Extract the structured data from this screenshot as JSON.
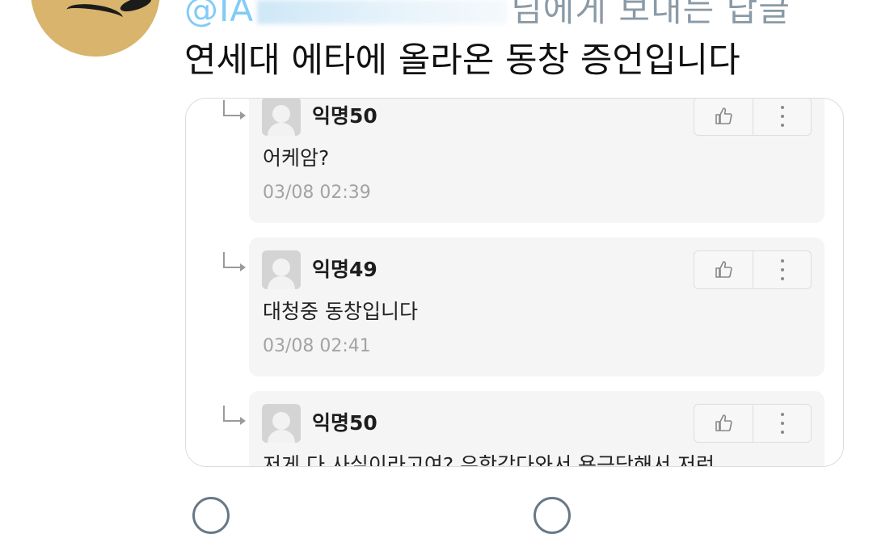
{
  "tweet": {
    "reply_prefix": "@IA",
    "reply_suffix": "님에게 보내는 답글",
    "text": "연세대 에타에 올라온 동창 증언입니다"
  },
  "comments": [
    {
      "name": "익명50",
      "text": "어케암?",
      "date": "03/08 02:39"
    },
    {
      "name": "익명49",
      "text": "대청중 동창입니다",
      "date": "03/08 02:41"
    },
    {
      "name": "익명50",
      "text": "저게 다 사실이라고여? 유학갔다와서 욕근당해서 저런",
      "date": ""
    }
  ],
  "icons": {
    "like": "thumbs-up-icon",
    "more": "more-vertical-icon",
    "reply_arrow": "reply-arrow-icon"
  },
  "colors": {
    "link": "#1da1f2",
    "card_border": "#d7dde2",
    "comment_bg": "#f5f5f5",
    "date": "#a3a3a3"
  }
}
